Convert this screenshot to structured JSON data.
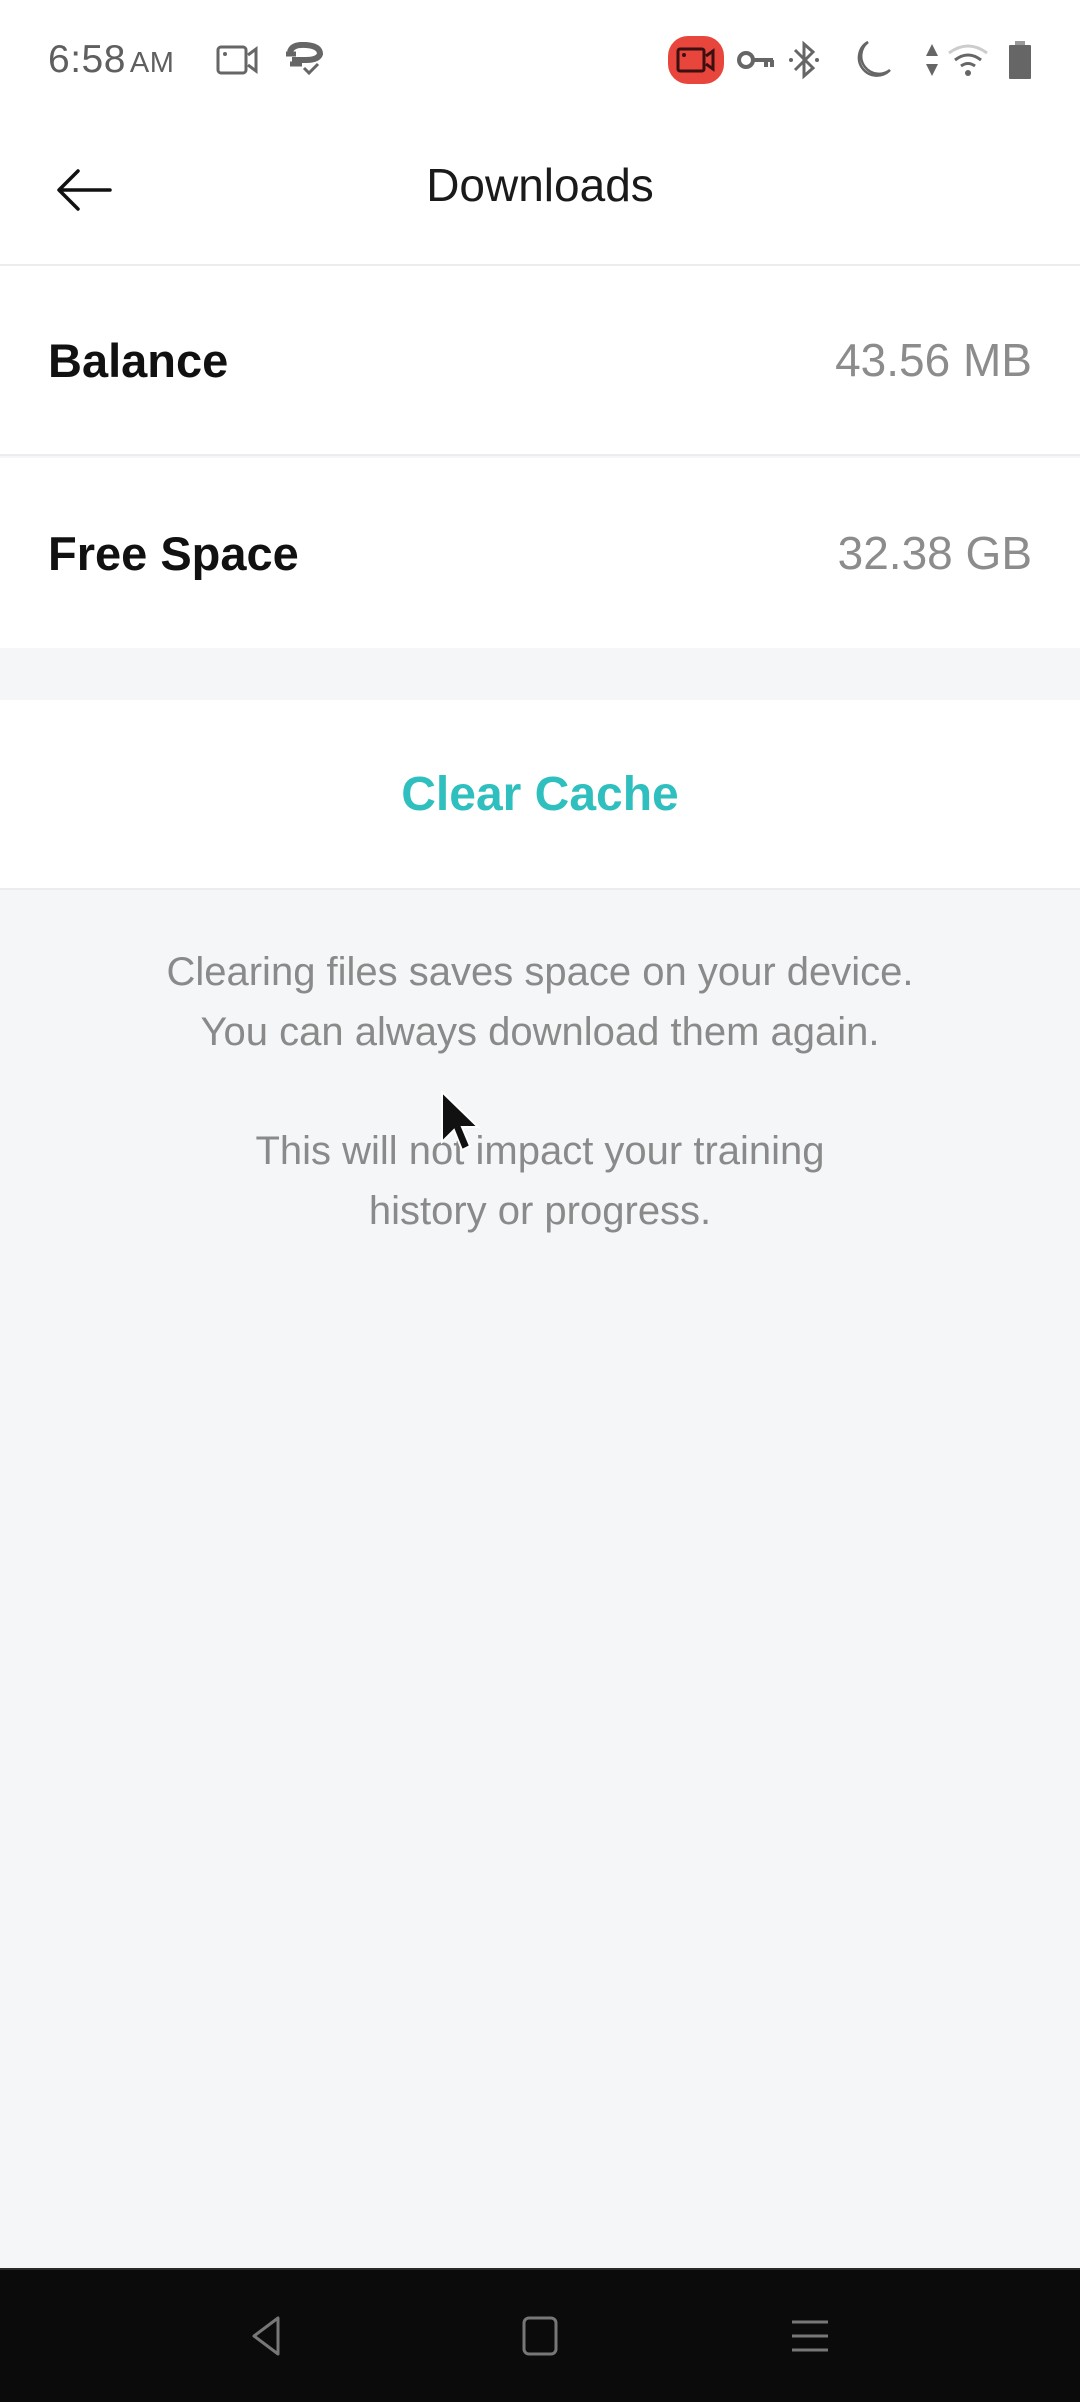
{
  "status_bar": {
    "time": "6:58",
    "ampm": "AM",
    "icons": [
      "screen-record-icon",
      "sync-check-icon",
      "recording-badge-icon",
      "vpn-key-icon",
      "bluetooth-icon",
      "do-not-disturb-moon-icon",
      "data-arrows-icon",
      "wifi-icon",
      "battery-icon"
    ],
    "recording_badge_color": "#e8453c"
  },
  "app_bar": {
    "title": "Downloads",
    "back_icon": "arrow-left-icon"
  },
  "storage": {
    "rows": [
      {
        "label": "Balance",
        "value": "43.56 MB"
      },
      {
        "label": "Free Space",
        "value": "32.38 GB"
      }
    ]
  },
  "actions": {
    "clear_cache_label": "Clear Cache",
    "accent_color": "#2fbfbf"
  },
  "info": {
    "line1a": "Clearing files saves space on your device.",
    "line1b": "You can always download them again.",
    "line2a": "This will not impact your training",
    "line2b": "history or progress."
  },
  "nav_bar": {
    "icons": [
      "nav-back-icon",
      "nav-home-icon",
      "nav-menu-icon"
    ]
  }
}
